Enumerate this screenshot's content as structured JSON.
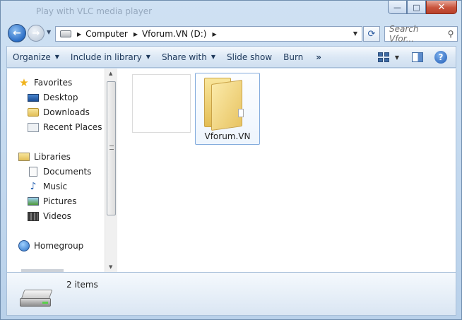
{
  "window": {
    "title": "Play with VLC media player",
    "caption_buttons": {
      "minimize": "—",
      "maximize": "□",
      "close": "✕"
    }
  },
  "navigation": {
    "breadcrumb": [
      "Computer",
      "Vforum.VN (D:)"
    ],
    "search_placeholder": "Search Vfor..."
  },
  "toolbar": {
    "items": [
      {
        "label": "Organize",
        "has_dropdown": true
      },
      {
        "label": "Include in library",
        "has_dropdown": true
      },
      {
        "label": "Share with",
        "has_dropdown": true
      },
      {
        "label": "Slide show",
        "has_dropdown": false
      },
      {
        "label": "Burn",
        "has_dropdown": false
      }
    ],
    "more": "»",
    "help": "?"
  },
  "sidebar": {
    "favorites_label": "Favorites",
    "favorites": [
      "Desktop",
      "Downloads",
      "Recent Places"
    ],
    "libraries_label": "Libraries",
    "libraries": [
      "Documents",
      "Music",
      "Pictures",
      "Videos"
    ],
    "homegroup_label": "Homegroup"
  },
  "content": {
    "items": [
      {
        "name": "",
        "type": "empty-thumbnail"
      },
      {
        "name": "Vforum.VN",
        "type": "folder",
        "selected": true
      }
    ]
  },
  "details": {
    "summary": "2 items"
  },
  "colors": {
    "chrome": "#cfe1f3",
    "toolbar_text": "#1e395b",
    "selection_border": "#84acdd",
    "folder": "#e8c463"
  }
}
